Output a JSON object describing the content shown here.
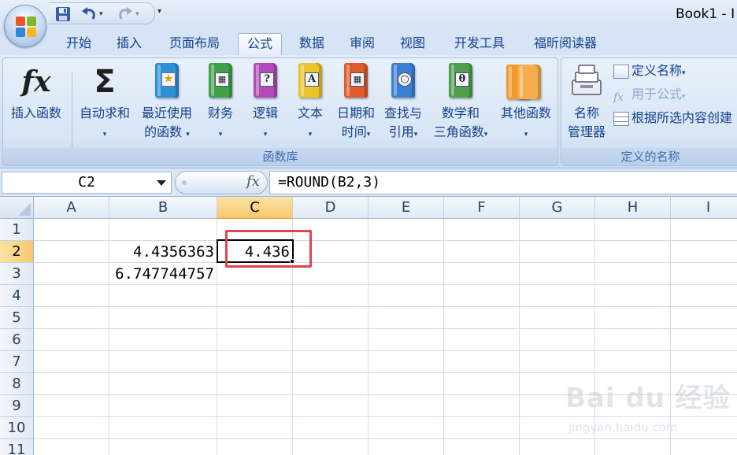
{
  "window": {
    "title": "Book1 - I"
  },
  "qat": {
    "save": "save-icon",
    "undo": "undo-icon",
    "redo": "redo-icon",
    "customize": "▾"
  },
  "tabs": [
    {
      "label": "开始",
      "active": false
    },
    {
      "label": "插入",
      "active": false
    },
    {
      "label": "页面布局",
      "active": false
    },
    {
      "label": "公式",
      "active": true
    },
    {
      "label": "数据",
      "active": false
    },
    {
      "label": "审阅",
      "active": false
    },
    {
      "label": "视图",
      "active": false
    },
    {
      "label": "开发工具",
      "active": false
    },
    {
      "label": "福昕阅读器",
      "active": false
    }
  ],
  "ribbon": {
    "function_library": {
      "label": "函数库",
      "insert_function": {
        "line1": "插入函数",
        "icon": "fx"
      },
      "autosum": {
        "line1": "自动求和",
        "icon": "Σ"
      },
      "recent": {
        "line1": "最近使用",
        "line2": "的函数"
      },
      "financial": {
        "line1": "财务"
      },
      "logical": {
        "line1": "逻辑",
        "glyph": "?"
      },
      "text": {
        "line1": "文本",
        "glyph": "A"
      },
      "datetime": {
        "line1": "日期和",
        "line2": "时间"
      },
      "lookup": {
        "line1": "查找与",
        "line2": "引用"
      },
      "math": {
        "line1": "数学和",
        "line2": "三角函数",
        "glyph": "θ"
      },
      "more": {
        "line1": "其他函数"
      }
    },
    "defined_names": {
      "label": "定义的名称",
      "name_manager": {
        "line1": "名称",
        "line2": "管理器"
      },
      "define_name": "定义名称",
      "use_in_formula": "用于公式",
      "create_from_selection": "根据所选内容创建"
    },
    "colors": {
      "financial": "#3fa24a",
      "logical": "#b14bb8",
      "text": "#e8c52b",
      "datetime": "#e05a2a",
      "lookup": "#3b7fd0",
      "math": "#4c9f4c",
      "more": "#f29a2e",
      "recent": "#2e8fd6"
    }
  },
  "formula_bar": {
    "name_box": "C2",
    "fx": "fx",
    "formula": "=ROUND(B2,3)"
  },
  "grid": {
    "columns": [
      "A",
      "B",
      "C",
      "D",
      "E",
      "F",
      "G",
      "H",
      "I"
    ],
    "selected_column": "C",
    "rows": [
      "1",
      "2",
      "3",
      "4",
      "5",
      "6",
      "7",
      "8",
      "9",
      "10",
      "11"
    ],
    "selected_row": "2",
    "cells": {
      "B2": "4.4356363",
      "C2": "4.436",
      "B3": "6.747744757"
    },
    "highlight_color": "#e0454a"
  },
  "watermark": {
    "brand": "Bai du 经验",
    "url": "jingyan.baidu.com"
  }
}
